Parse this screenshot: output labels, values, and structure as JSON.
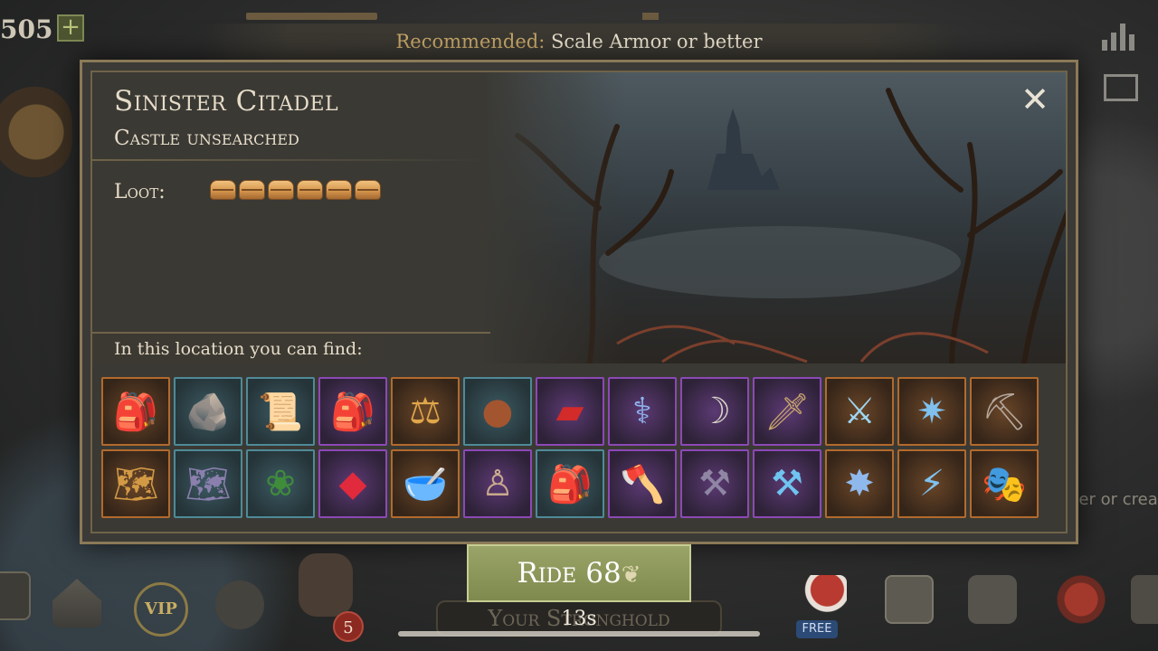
{
  "hud": {
    "coins": "505",
    "plus_label": "+"
  },
  "recommendation": {
    "label": "Recommended:",
    "value": "Scale Armor or better"
  },
  "location": {
    "title": "Sinister Citadel",
    "status": "Castle unsearched",
    "loot_label": "Loot:",
    "loot_chests": 6,
    "close_label": "✕",
    "find_label": "In this location you can find:"
  },
  "items": [
    {
      "name": "hunter-backpack",
      "rarity": "orange",
      "glyph": "🎒",
      "color": "#c49a66"
    },
    {
      "name": "rock-shard",
      "rarity": "blue",
      "glyph": "🪨",
      "color": "#9fc2c2"
    },
    {
      "name": "scroll-bundle",
      "rarity": "blue",
      "glyph": "📜",
      "color": "#e5c7a5"
    },
    {
      "name": "armored-backpack",
      "rarity": "purple",
      "glyph": "🎒",
      "color": "#9fb0c8"
    },
    {
      "name": "scales",
      "rarity": "orange",
      "glyph": "⚖",
      "color": "#e0a64a"
    },
    {
      "name": "leather-pouch",
      "rarity": "blue",
      "glyph": "●",
      "color": "#a3552f"
    },
    {
      "name": "red-cushion",
      "rarity": "purple",
      "glyph": "▰",
      "color": "#d32a2a"
    },
    {
      "name": "ice-staff",
      "rarity": "purple",
      "glyph": "⚕",
      "color": "#8fb6f0"
    },
    {
      "name": "sickle",
      "rarity": "purple",
      "glyph": "☽",
      "color": "#d8d4c8"
    },
    {
      "name": "dagger",
      "rarity": "purple",
      "glyph": "🗡",
      "color": "#c9a66b"
    },
    {
      "name": "frost-sword",
      "rarity": "orange",
      "glyph": "⚔",
      "color": "#9ed6f2"
    },
    {
      "name": "spiked-mace",
      "rarity": "orange",
      "glyph": "✷",
      "color": "#7fc0ee"
    },
    {
      "name": "pickaxe",
      "rarity": "orange",
      "glyph": "⛏",
      "color": "#b5a9a0"
    },
    {
      "name": "ancient-map",
      "rarity": "orange",
      "glyph": "🗺",
      "color": "#d39a45"
    },
    {
      "name": "rolled-map",
      "rarity": "blue",
      "glyph": "🗺",
      "color": "#8b7fae"
    },
    {
      "name": "holiday-wreath",
      "rarity": "blue",
      "glyph": "❀",
      "color": "#3f8c3a"
    },
    {
      "name": "ruby-gem",
      "rarity": "purple",
      "glyph": "◆",
      "color": "#e12a3c"
    },
    {
      "name": "mortar",
      "rarity": "orange",
      "glyph": "🥣",
      "color": "#9a9aa8"
    },
    {
      "name": "voodoo-doll",
      "rarity": "purple",
      "glyph": "♙",
      "color": "#c9aa8d"
    },
    {
      "name": "travel-sack",
      "rarity": "blue",
      "glyph": "🎒",
      "color": "#7a5a3c"
    },
    {
      "name": "battle-axe",
      "rarity": "purple",
      "glyph": "🪓",
      "color": "#c9c4bb"
    },
    {
      "name": "scythe",
      "rarity": "purple",
      "glyph": "⚒",
      "color": "#8f86a3"
    },
    {
      "name": "frost-scythe",
      "rarity": "purple",
      "glyph": "⚒",
      "color": "#6fc4f0"
    },
    {
      "name": "frost-mace",
      "rarity": "orange",
      "glyph": "✸",
      "color": "#8fb9ec"
    },
    {
      "name": "lightning-sword",
      "rarity": "orange",
      "glyph": "⚡",
      "color": "#7ec2f0"
    },
    {
      "name": "plague-mask",
      "rarity": "orange",
      "glyph": "🎭",
      "color": "#cfcfcf"
    }
  ],
  "ride": {
    "label": "Ride",
    "cost": "68",
    "currency_icon": "wheat-icon"
  },
  "dock": {
    "stronghold_label": "Your Stronghold",
    "timer": "13s",
    "badge_count": "5",
    "free_label": "FREE",
    "vip_label": "VIP",
    "side_text": "ider or crea"
  }
}
